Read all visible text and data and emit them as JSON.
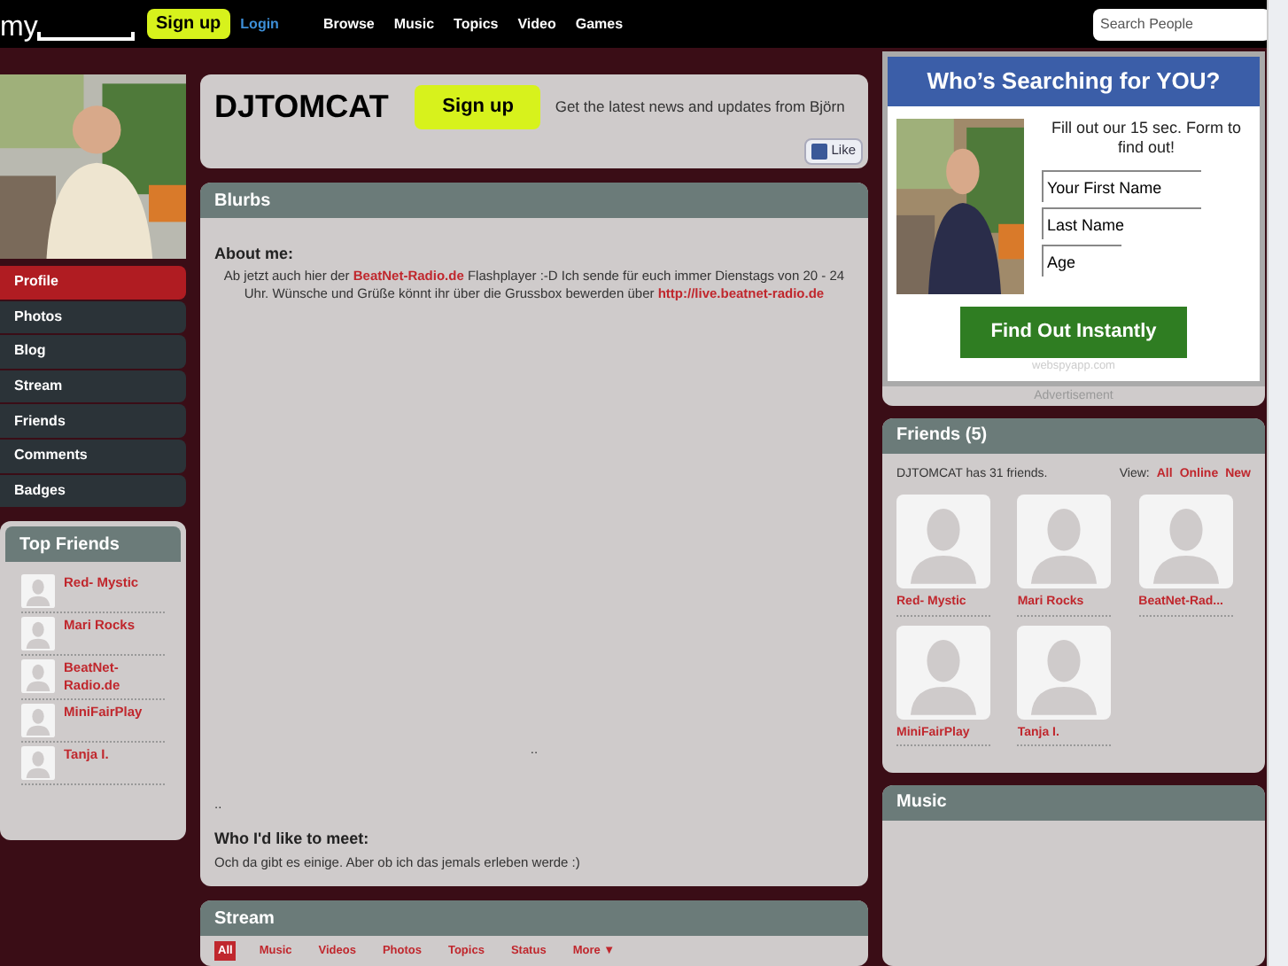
{
  "top_nav": {
    "logo": "my",
    "signup": "Sign up",
    "login": "Login",
    "links": [
      "Browse",
      "Music",
      "Topics",
      "Video",
      "Games"
    ],
    "search": {
      "placeholder": "Search People"
    }
  },
  "sidebar": {
    "items": [
      {
        "label": "Profile",
        "selected": true
      },
      {
        "label": "Photos",
        "selected": false
      },
      {
        "label": "Blog",
        "selected": false
      },
      {
        "label": "Stream",
        "selected": false
      },
      {
        "label": "Friends",
        "selected": false
      },
      {
        "label": "Comments",
        "selected": false
      },
      {
        "label": "Badges",
        "selected": false
      }
    ],
    "top_friends": {
      "title": "Top Friends",
      "items": [
        "Red- Mystic",
        "Mari Rocks",
        "BeatNet-Radio.de",
        "MiniFairPlay",
        "Tanja I."
      ]
    }
  },
  "header": {
    "name": "DJTOMCAT",
    "signup": "Sign up",
    "tagline": "Get the latest news and updates from Björn",
    "like": "Like"
  },
  "blurbs": {
    "title": "Blurbs",
    "about_heading": "About me:",
    "about_text": [
      {
        "kind": "text",
        "text": "Ab jetzt auch hier der "
      },
      {
        "kind": "link",
        "text": "BeatNet-Radio.de"
      },
      {
        "kind": "text",
        "text": " Flashplayer :-D Ich sende für euch immer Dienstags von 20 - 24 Uhr. Wünsche und Grüße könnt ihr über die Grussbox bewerden über "
      },
      {
        "kind": "link",
        "text": "http://live.beatnet-radio.de"
      }
    ],
    "separator_1": "..",
    "separator_2": "..",
    "meet_heading": "Who I'd like to meet:",
    "meet_text": "Och da gibt es einige. Aber ob ich das jemals erleben werde :)"
  },
  "stream": {
    "title": "Stream",
    "tabs": [
      {
        "label": "All",
        "selected": true
      },
      {
        "label": "Music",
        "selected": false
      },
      {
        "label": "Videos",
        "selected": false
      },
      {
        "label": "Photos",
        "selected": false
      },
      {
        "label": "Topics",
        "selected": false
      },
      {
        "label": "Status",
        "selected": false
      },
      {
        "label": "More ▼",
        "selected": false
      }
    ]
  },
  "ad": {
    "title": "Who’s Searching for YOU?",
    "text": "Fill out our 15 sec. Form to find out!",
    "fields": [
      {
        "placeholder": "Your First Name"
      },
      {
        "placeholder": "Last Name"
      },
      {
        "placeholder": "Age"
      }
    ],
    "button": "Find Out Instantly",
    "source": "webspyapp.com",
    "label": "Advertisement"
  },
  "friends": {
    "title": "Friends (5)",
    "summary": "DJTOMCAT has 31 friends.",
    "view_label": "View:",
    "view_links": [
      "All",
      "Online",
      "New"
    ],
    "items": [
      "Red- Mystic",
      "Mari Rocks",
      "BeatNet-Rad...",
      "MiniFairPlay",
      "Tanja I."
    ]
  },
  "music": {
    "title": "Music"
  }
}
